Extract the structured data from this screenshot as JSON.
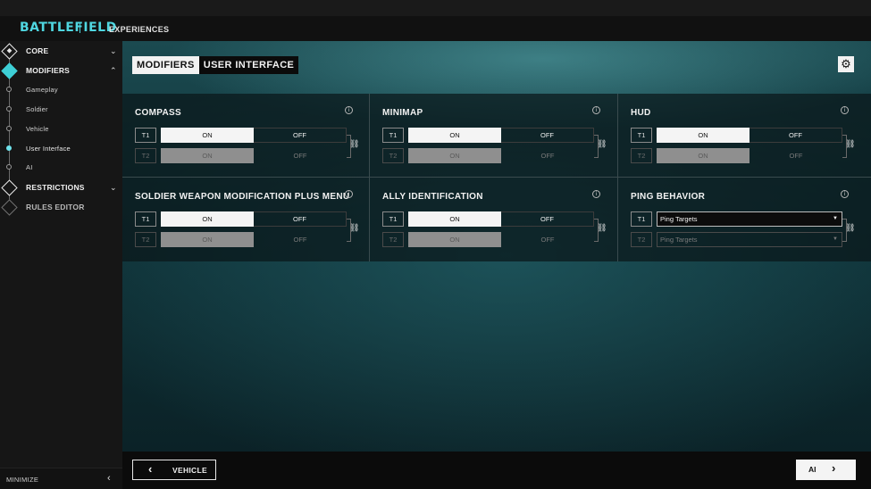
{
  "app": {
    "logo": "BATTLEFIELD",
    "nav_experiences": "EXPERIENCES"
  },
  "sidebar": {
    "core": "CORE",
    "modifiers": "MODIFIERS",
    "sub_items": [
      "Gameplay",
      "Soldier",
      "Vehicle",
      "User Interface",
      "AI"
    ],
    "active_sub": "User Interface",
    "restrictions": "RESTRICTIONS",
    "rules_editor": "RULES EDITOR",
    "minimize": "MINIMIZE"
  },
  "tabs": {
    "primary": "MODIFIERS",
    "secondary": "USER INTERFACE"
  },
  "toggle_labels": {
    "on": "ON",
    "off": "OFF",
    "t1": "T1",
    "t2": "T2"
  },
  "cards": {
    "compass": {
      "title": "COMPASS",
      "t1_value": "ON",
      "t2_value": "ON",
      "t2_linked": true
    },
    "minimap": {
      "title": "MINIMAP",
      "t1_value": "ON",
      "t2_value": "ON",
      "t2_linked": true
    },
    "hud": {
      "title": "HUD",
      "t1_value": "ON",
      "t2_value": "ON",
      "t2_linked": true
    },
    "soldier_weapon": {
      "title": "SOLDIER WEAPON MODIFICATION PLUS MENU",
      "t1_value": "ON",
      "t2_value": "ON",
      "t2_linked": true
    },
    "ally_id": {
      "title": "ALLY IDENTIFICATION",
      "t1_value": "ON",
      "t2_value": "ON",
      "t2_linked": true
    },
    "ping": {
      "title": "PING BEHAVIOR",
      "t1_value": "Ping Targets",
      "t2_value": "Ping Targets",
      "t2_linked": true
    }
  },
  "footer": {
    "prev_label": "VEHICLE",
    "next_label": "AI"
  },
  "colors": {
    "accent": "#4fd6e0",
    "active_nav": "#6fe3ec",
    "selected_option": "#f4f4f4"
  }
}
